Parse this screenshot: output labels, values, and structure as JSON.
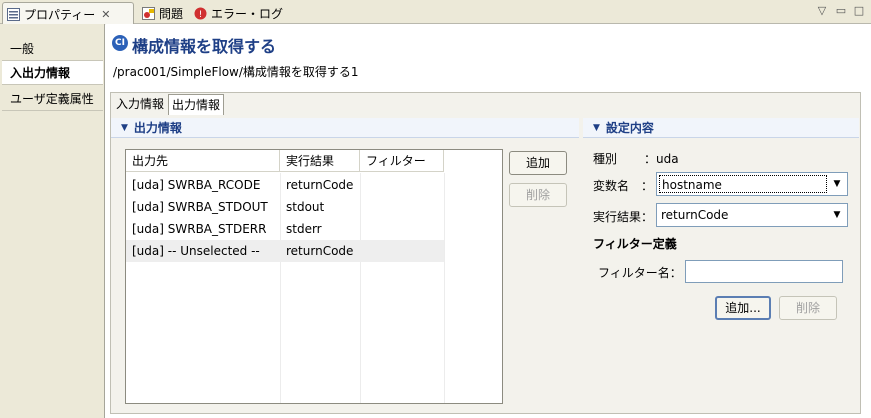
{
  "view_tabs": [
    {
      "label": "プロパティー",
      "icon": "properties-icon",
      "active": true
    },
    {
      "label": "問題",
      "icon": "problems-icon",
      "active": false
    },
    {
      "label": "エラー・ログ",
      "icon": "error-log-icon",
      "active": false
    }
  ],
  "window_controls": {
    "menu": "▽",
    "minimize": "▭",
    "maximize": "□"
  },
  "nav": {
    "items": [
      {
        "label": "一般"
      },
      {
        "label": "入出力情報"
      },
      {
        "label": "ユーザ定義属性"
      }
    ]
  },
  "header": {
    "icon_text": "CI",
    "title": "構成情報を取得する",
    "path": "/prac001/SimpleFlow/構成情報を取得する1"
  },
  "prop_tabs": [
    {
      "label": "入力情報"
    },
    {
      "label": "出力情報"
    }
  ],
  "output_section": {
    "title": "出力情報",
    "columns": [
      "出力先",
      "実行結果",
      "フィルター"
    ],
    "rows": [
      {
        "dest": "[uda] SWRBA_RCODE",
        "result": "returnCode",
        "filter": ""
      },
      {
        "dest": "[uda] SWRBA_STDOUT",
        "result": "stdout",
        "filter": ""
      },
      {
        "dest": "[uda] SWRBA_STDERR",
        "result": "stderr",
        "filter": ""
      },
      {
        "dest": "[uda] -- Unselected --",
        "result": "returnCode",
        "filter": ""
      }
    ],
    "add_button": "追加",
    "delete_button": "削除"
  },
  "settings_section": {
    "title": "設定内容",
    "type_label": "種別",
    "type_value": "：uda",
    "var_label": "変数名　：",
    "var_value": "hostname",
    "result_label": "実行結果：",
    "result_value": "returnCode",
    "filter_def_label": "フィルター定義",
    "filter_name_label": "フィルター名：",
    "filter_name_value": "",
    "add_button": "追加...",
    "delete_button": "削除"
  },
  "colors": {
    "accent": "#1e3f86",
    "chrome": "#ece9d8"
  }
}
